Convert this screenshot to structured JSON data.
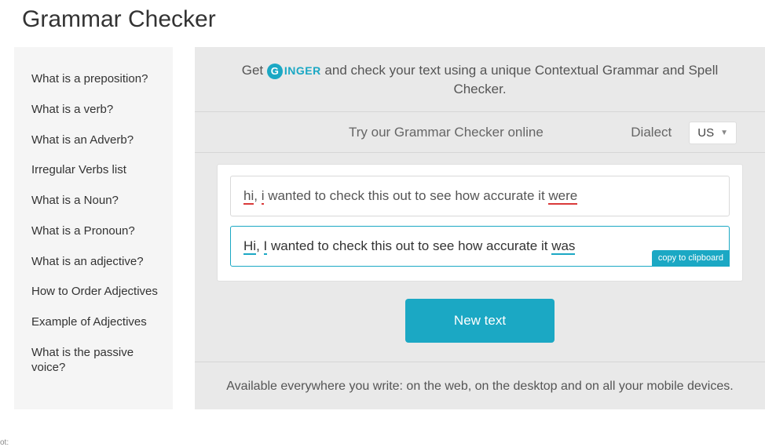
{
  "page_title": "Grammar Checker",
  "sidebar": {
    "items": [
      "What is a preposition?",
      "What is a verb?",
      "What is an Adverb?",
      "Irregular Verbs list",
      "What is a Noun?",
      "What is a Pronoun?",
      "What is an adjective?",
      "How to Order Adjectives",
      "Example of Adjectives",
      "What is the passive voice?"
    ]
  },
  "promo": {
    "prefix": "Get ",
    "logo_letter": "G",
    "logo_text": "INGER",
    "suffix": " and check your text using a unique Contextual Grammar and Spell Checker."
  },
  "try_row": {
    "text": "Try our Grammar Checker online",
    "dialect_label": "Dialect",
    "dialect_value": "US"
  },
  "checker": {
    "input": {
      "w0": "hi",
      "w1": ", ",
      "w2": "i",
      "w3": " wanted to check this out to see how accurate it ",
      "w4": "were"
    },
    "output": {
      "w0": "Hi",
      "w1": ", ",
      "w2": "I",
      "w3": " wanted to check this out to see how accurate it ",
      "w4": "was"
    },
    "copy_label": "copy to clipboard"
  },
  "new_text_label": "New text",
  "footer_text": "Available everywhere you write: on the web, on the desktop and on all your mobile devices.",
  "tiny_tag": "ot:"
}
